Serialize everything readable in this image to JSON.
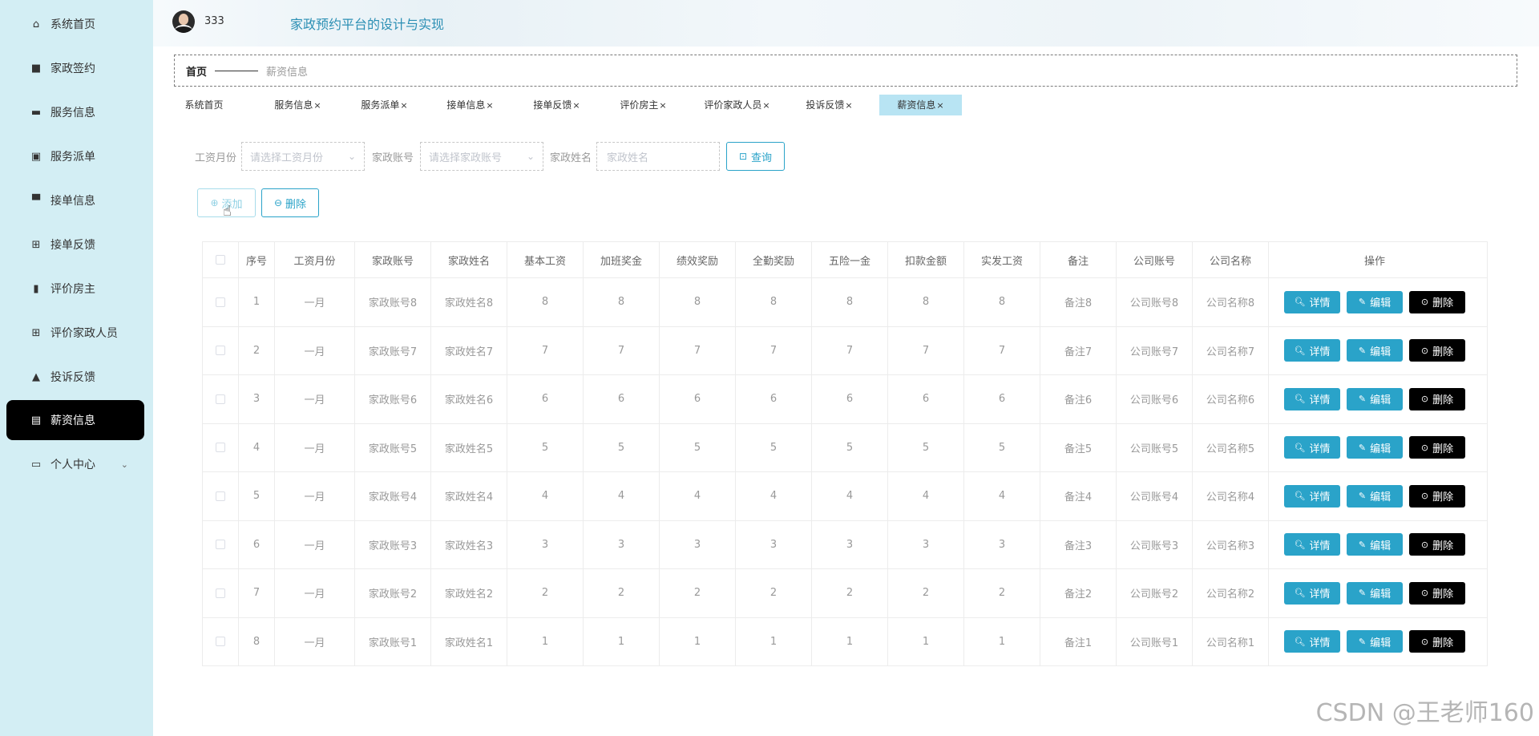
{
  "sidebar": {
    "items": [
      {
        "label": "系统首页",
        "icon": "home-icon",
        "glyph": "⌂"
      },
      {
        "label": "家政签约",
        "icon": "briefcase-icon",
        "glyph": "■"
      },
      {
        "label": "服务信息",
        "icon": "ticket-icon",
        "glyph": "▬"
      },
      {
        "label": "服务派单",
        "icon": "chart-icon",
        "glyph": "▣"
      },
      {
        "label": "接单信息",
        "icon": "monitor-icon",
        "glyph": "▀"
      },
      {
        "label": "接单反馈",
        "icon": "grid-icon",
        "glyph": "⊞"
      },
      {
        "label": "评价房主",
        "icon": "bar-chart-icon",
        "glyph": "▮"
      },
      {
        "label": "评价家政人员",
        "icon": "grid-icon",
        "glyph": "⊞"
      },
      {
        "label": "投诉反馈",
        "icon": "user-icon",
        "glyph": "▲"
      },
      {
        "label": "薪资信息",
        "icon": "clipboard-icon",
        "glyph": "▤"
      },
      {
        "label": "个人中心",
        "icon": "wallet-icon",
        "glyph": "▭"
      }
    ]
  },
  "header": {
    "username": "333",
    "title": "家政预约平台的设计与实现"
  },
  "breadcrumb": {
    "home": "首页",
    "current": "薪资信息"
  },
  "tags": [
    {
      "label": "系统首页",
      "closable": false
    },
    {
      "label": "服务信息",
      "closable": true
    },
    {
      "label": "服务派单",
      "closable": true
    },
    {
      "label": "接单信息",
      "closable": true
    },
    {
      "label": "接单反馈",
      "closable": true
    },
    {
      "label": "评价房主",
      "closable": true
    },
    {
      "label": "评价家政人员",
      "closable": true
    },
    {
      "label": "投诉反馈",
      "closable": true
    },
    {
      "label": "薪资信息",
      "closable": true
    }
  ],
  "tag_close_glyph": "×",
  "search": {
    "month_label": "工资月份",
    "month_placeholder": "请选择工资月份",
    "account_label": "家政账号",
    "account_placeholder": "请选择家政账号",
    "name_label": "家政姓名",
    "name_placeholder": "家政姓名",
    "query_label": "查询"
  },
  "actions": {
    "add_label": "添加",
    "delete_label": "删除"
  },
  "table": {
    "headers": [
      "序号",
      "工资月份",
      "家政账号",
      "家政姓名",
      "基本工资",
      "加班奖金",
      "绩效奖励",
      "全勤奖励",
      "五险一金",
      "扣款金额",
      "实发工资",
      "备注",
      "公司账号",
      "公司名称",
      "操作"
    ],
    "rows": [
      [
        "1",
        "一月",
        "家政账号8",
        "家政姓名8",
        "8",
        "8",
        "8",
        "8",
        "8",
        "8",
        "8",
        "备注8",
        "公司账号8",
        "公司名称8"
      ],
      [
        "2",
        "一月",
        "家政账号7",
        "家政姓名7",
        "7",
        "7",
        "7",
        "7",
        "7",
        "7",
        "7",
        "备注7",
        "公司账号7",
        "公司名称7"
      ],
      [
        "3",
        "一月",
        "家政账号6",
        "家政姓名6",
        "6",
        "6",
        "6",
        "6",
        "6",
        "6",
        "6",
        "备注6",
        "公司账号6",
        "公司名称6"
      ],
      [
        "4",
        "一月",
        "家政账号5",
        "家政姓名5",
        "5",
        "5",
        "5",
        "5",
        "5",
        "5",
        "5",
        "备注5",
        "公司账号5",
        "公司名称5"
      ],
      [
        "5",
        "一月",
        "家政账号4",
        "家政姓名4",
        "4",
        "4",
        "4",
        "4",
        "4",
        "4",
        "4",
        "备注4",
        "公司账号4",
        "公司名称4"
      ],
      [
        "6",
        "一月",
        "家政账号3",
        "家政姓名3",
        "3",
        "3",
        "3",
        "3",
        "3",
        "3",
        "3",
        "备注3",
        "公司账号3",
        "公司名称3"
      ],
      [
        "7",
        "一月",
        "家政账号2",
        "家政姓名2",
        "2",
        "2",
        "2",
        "2",
        "2",
        "2",
        "2",
        "备注2",
        "公司账号2",
        "公司名称2"
      ],
      [
        "8",
        "一月",
        "家政账号1",
        "家政姓名1",
        "1",
        "1",
        "1",
        "1",
        "1",
        "1",
        "1",
        "备注1",
        "公司账号1",
        "公司名称1"
      ]
    ],
    "op_detail": "详情",
    "op_edit": "编辑",
    "op_delete": "删除"
  },
  "watermark": "CSDN @王老师160",
  "colors": {
    "sidebar_bg": "#d3eef4",
    "accent": "#2aa3c9",
    "active_menu": "#000000",
    "active_tag": "#b8e4f3"
  }
}
